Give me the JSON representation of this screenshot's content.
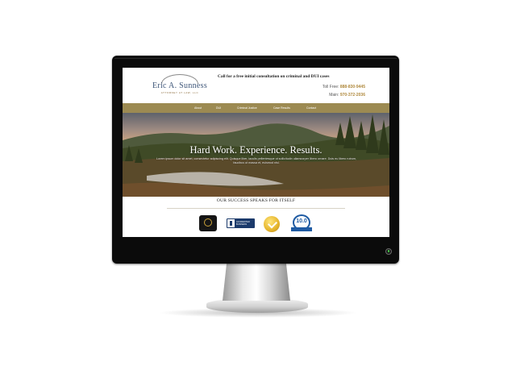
{
  "header": {
    "logo_name": "Eric A. Sunness",
    "logo_sub": "ATTORNEY AT LAW, LLC",
    "cta": "Call for a free initial consultation on criminal and DUI cases",
    "toll_free_label": "Toll Free:",
    "toll_free_number": "888-830-9445",
    "main_label": "Main:",
    "main_number": "970-372-2036"
  },
  "nav": {
    "items": [
      {
        "label": "About"
      },
      {
        "label": "DUI"
      },
      {
        "label": "Criminal Justice"
      },
      {
        "label": "Case Results"
      },
      {
        "label": "Contact"
      }
    ]
  },
  "hero": {
    "title": "Hard Work. Experience. Results.",
    "body": "Lorem ipsum dolor sit amet, consectetur adipiscing elit. Quisque liber, iaculis pellentesque ut sollicitudin ullamcorper libero ornare. Duis eu libero rutrum, faucibus ut massa et, euismod nisl.",
    "palette": {
      "sky": "#9a8b84",
      "field": "#4b5a2c",
      "river": "#c9c4bd"
    }
  },
  "success": {
    "heading": "OUR SUCCESS SPEAKS FOR ITSELF",
    "badges": [
      {
        "icon": "super-lawyers-badge-icon"
      },
      {
        "icon": "bbb-accredited-badge-icon",
        "text_1": "ACCREDITED",
        "text_2": "BUSINESS"
      },
      {
        "icon": "gold-check-seal-icon"
      },
      {
        "icon": "avvo-rating-badge-icon",
        "score": "10.0"
      }
    ]
  },
  "colors": {
    "nav_bg": "#9c8a52",
    "accent_gold": "#b08a3e",
    "logo_blue": "#3d5578",
    "bezel": "#0b0b0b"
  }
}
